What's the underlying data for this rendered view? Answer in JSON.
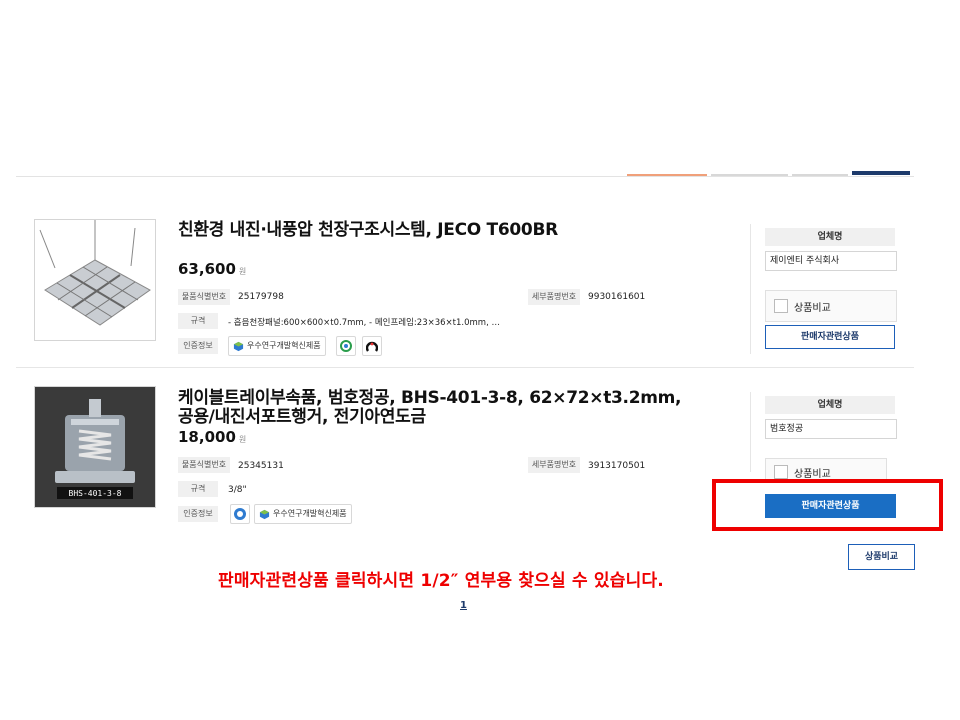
{
  "products": [
    {
      "title": "친환경 내진·내풍압 천장구조시스템, JECO T600BR",
      "price": "63,600",
      "currency": "원",
      "id_label": "물품식별번호",
      "id_value": "25179798",
      "detail_label": "세부품명번호",
      "detail_value": "9930161601",
      "spec_label": "규격",
      "spec_value": "- 흡음천장패널:600×600×t0.7mm, - 메인프레임:23×36×t1.0mm, …",
      "cert_label": "인증정보",
      "cert_badge": "우수연구개발혁신제품",
      "company_label": "업체명",
      "company": "제이엔티 주식회사",
      "compare_label": "상품비교",
      "related_label": "판매자관련상품"
    },
    {
      "title_line1": "케이블트레이부속품, 범호정공, BHS-401-3-8, 62×72×t3.2mm,",
      "title_line2": "공용/내진서포트행거, 전기아연도금",
      "price": "18,000",
      "currency": "원",
      "id_label": "물품식별번호",
      "id_value": "25345131",
      "detail_label": "세부품명번호",
      "detail_value": "3913170501",
      "spec_label": "규격",
      "spec_value": "3/8\"",
      "cert_label": "인증정보",
      "cert_badge": "우수연구개발혁신제품",
      "image_caption": "BHS-401-3-8",
      "company_label": "업체명",
      "company": "범호정공",
      "compare_label": "상품비교",
      "related_label": "판매자관련상품"
    }
  ],
  "compare_button": "상품비교",
  "notice": "판매자관련상품 클릭하시면 1/2″ 연부용 찾으실 수 있습니다.",
  "pagination": {
    "current": "1"
  },
  "colors": {
    "accent": "#1a6ec4",
    "highlight": "#ee0000",
    "dark_navy": "#1d3a6b"
  }
}
